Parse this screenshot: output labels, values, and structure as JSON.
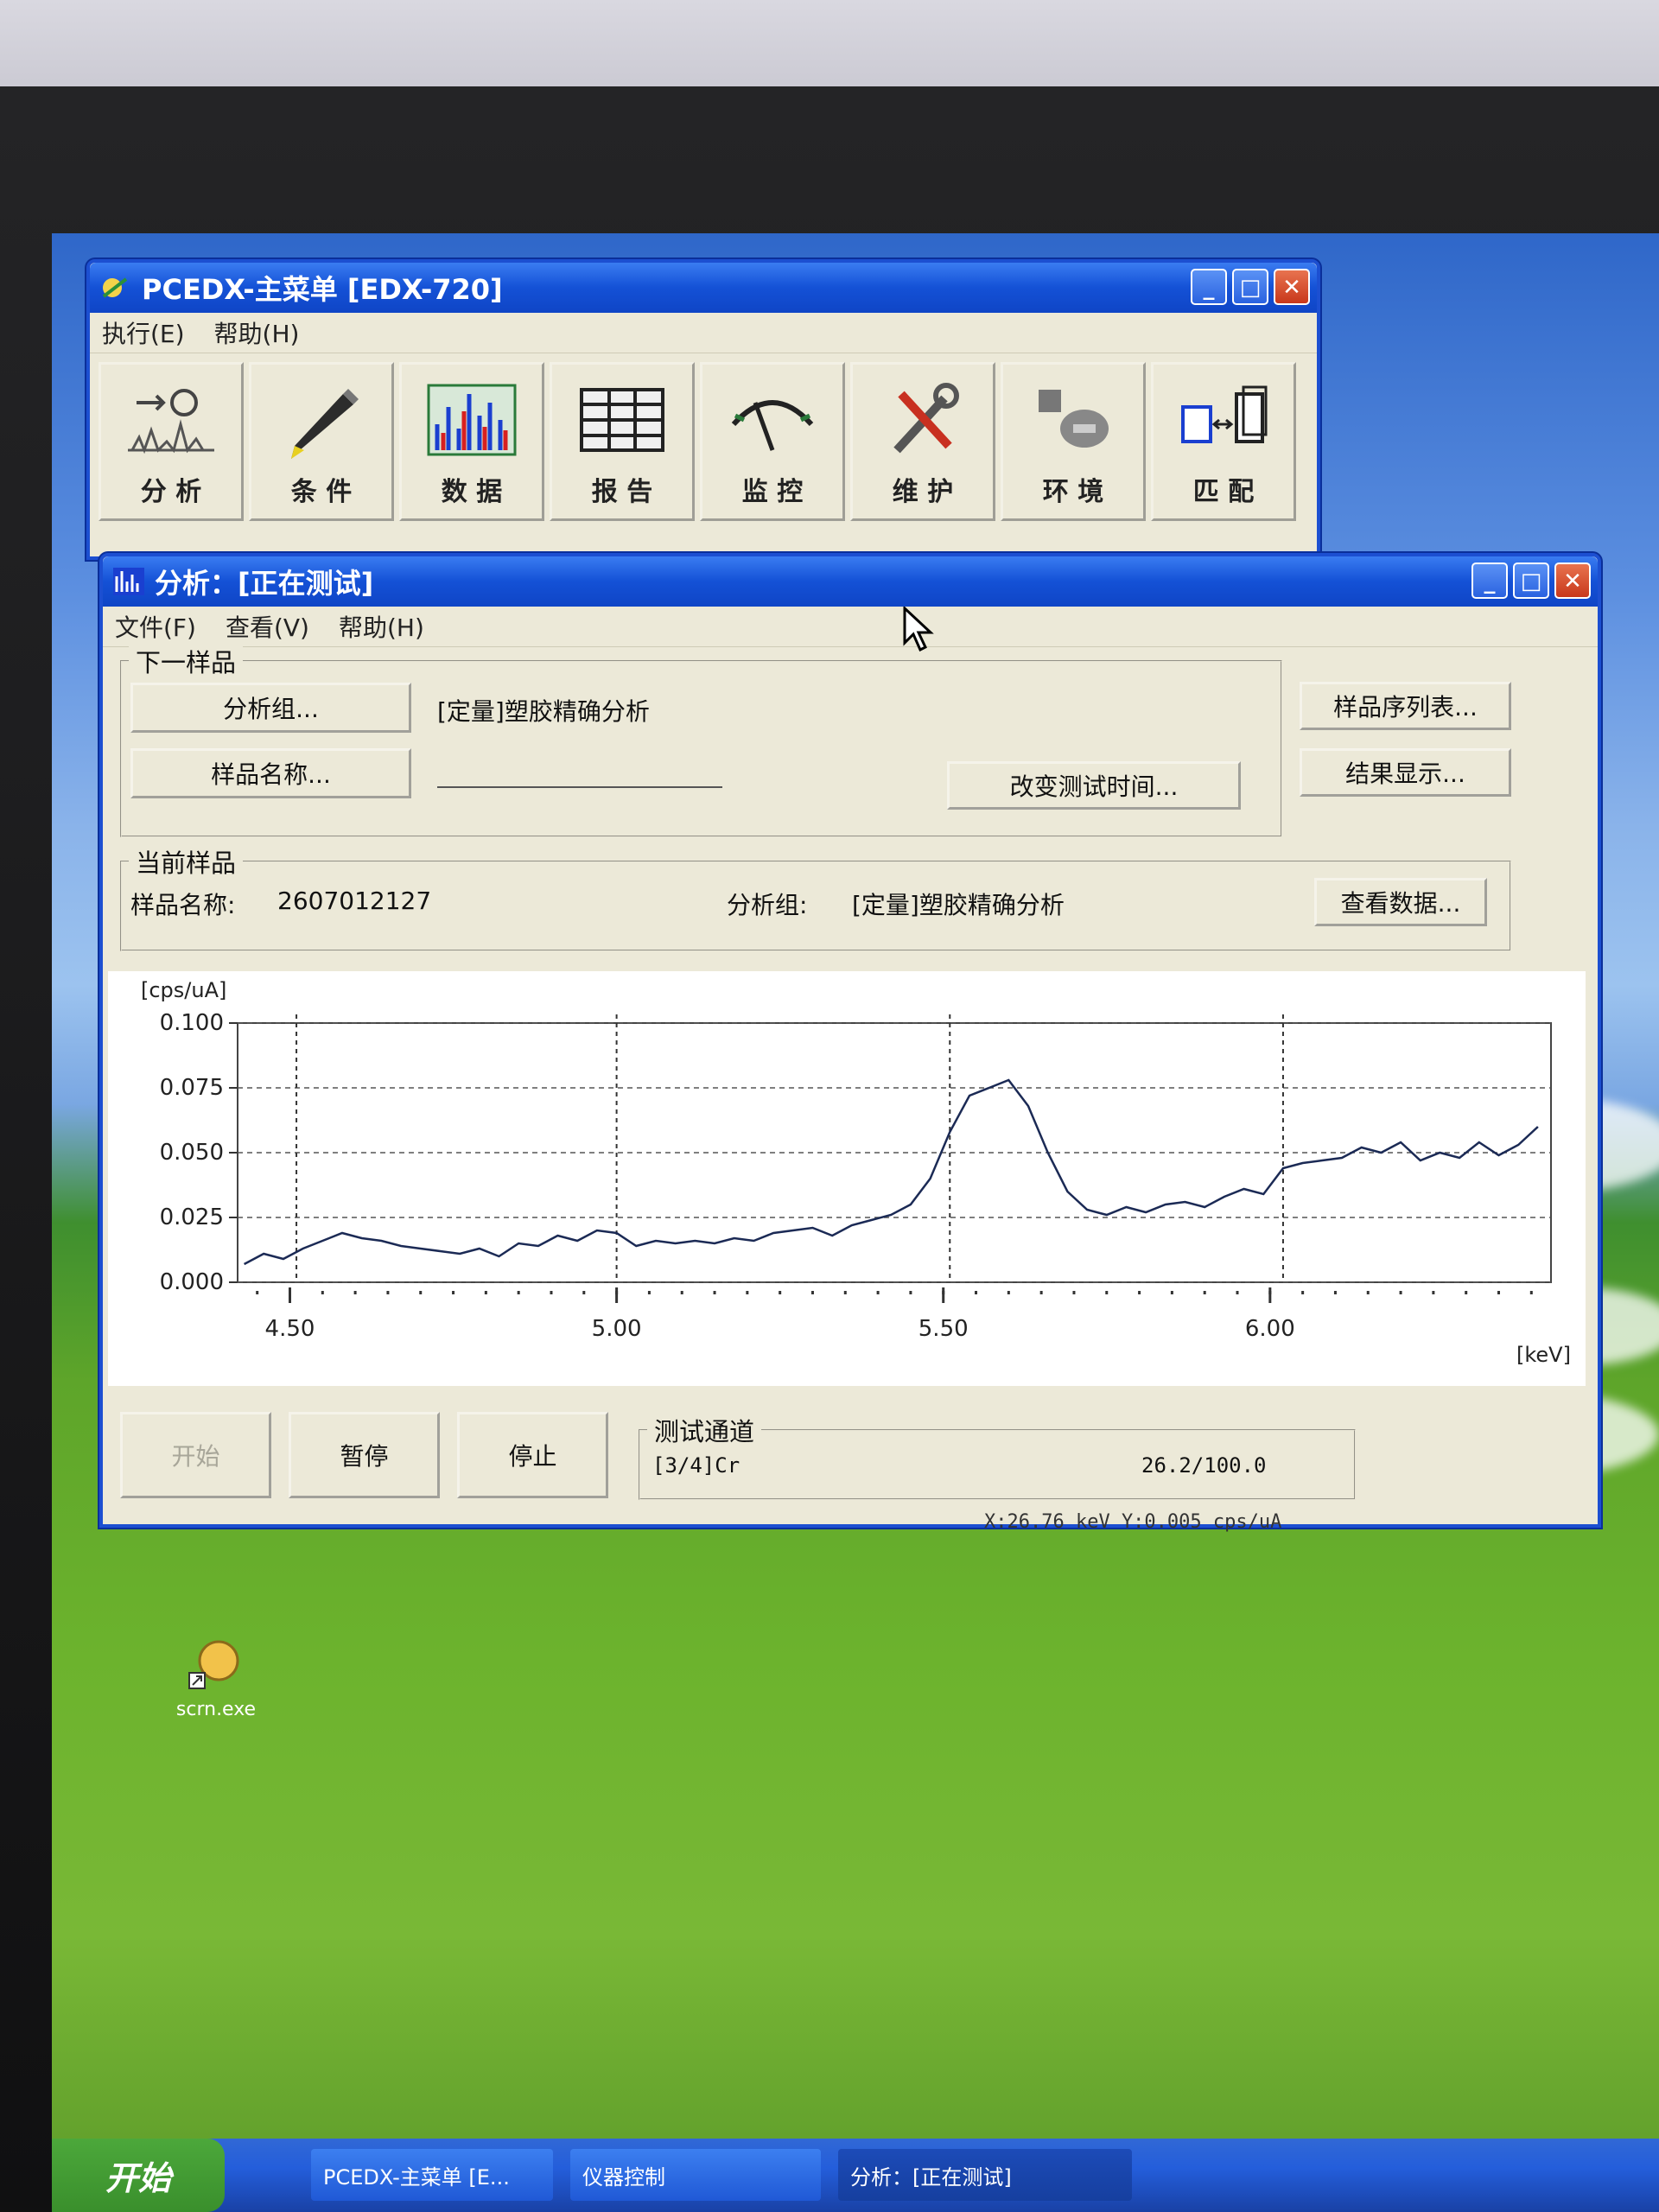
{
  "main_window": {
    "title": "PCEDX-主菜单   [EDX-720]",
    "menu": [
      "执行(E)",
      "帮助(H)"
    ],
    "toolbar": [
      {
        "label": "分 析",
        "icon": "spectrum-analysis-icon"
      },
      {
        "label": "条 件",
        "icon": "pencil-icon"
      },
      {
        "label": "数 据",
        "icon": "bar-chart-icon"
      },
      {
        "label": "报 告",
        "icon": "table-icon"
      },
      {
        "label": "监 控",
        "icon": "gauge-icon"
      },
      {
        "label": "维 护",
        "icon": "tools-icon"
      },
      {
        "label": "环 境",
        "icon": "disk-icon"
      },
      {
        "label": "匹 配",
        "icon": "match-icon"
      }
    ]
  },
  "analysis_window": {
    "title": "分析：[正在测试]",
    "menu": [
      "文件(F)",
      "查看(V)",
      "帮助(H)"
    ],
    "next_sample": {
      "group_label": "下一样品",
      "analysis_group_button": "分析组...",
      "analysis_group_value": "[定量]塑胶精确分析",
      "sample_name_button": "样品名称...",
      "sample_name_value": "",
      "change_time_button": "改变测试时间..."
    },
    "side_buttons": {
      "sample_list": "样品序列表...",
      "result_display": "结果显示..."
    },
    "current_sample": {
      "group_label": "当前样品",
      "sample_name_label": "样品名称:",
      "sample_name_value": "2607012127",
      "analysis_group_label": "分析组:",
      "analysis_group_value": "[定量]塑胶精确分析",
      "view_data_button": "查看数据..."
    },
    "controls": {
      "start": "开始",
      "pause": "暂停",
      "stop": "停止"
    },
    "channel": {
      "group_label": "测试通道",
      "name": "[3/4]Cr",
      "progress": "26.2/100.0"
    },
    "status_bar": "X:26.76 keV  Y:0.005 cps/uA"
  },
  "chart_data": {
    "type": "line",
    "ylabel": "[cps/uA]",
    "xlabel": "[keV]",
    "xlim": [
      4.42,
      6.43
    ],
    "ylim": [
      0.0,
      0.1
    ],
    "x_ticks": [
      "4.50",
      "5.00",
      "5.50",
      "6.00"
    ],
    "y_ticks": [
      "0.100",
      "0.075",
      "0.050",
      "0.025",
      "0.000"
    ],
    "marker_lines_kev": [
      4.51,
      5.0,
      5.51,
      6.02
    ],
    "series": [
      {
        "x": [
          4.43,
          4.46,
          4.49,
          4.52,
          4.55,
          4.58,
          4.61,
          4.64,
          4.67,
          4.7,
          4.73,
          4.76,
          4.79,
          4.82,
          4.85,
          4.88,
          4.91,
          4.94,
          4.97,
          5.0,
          5.03,
          5.06,
          5.09,
          5.12,
          5.15,
          5.18,
          5.21,
          5.24,
          5.27,
          5.3,
          5.33,
          5.36,
          5.39,
          5.42,
          5.45,
          5.48,
          5.51,
          5.54,
          5.57,
          5.6,
          5.63,
          5.66,
          5.69,
          5.72,
          5.75,
          5.78,
          5.81,
          5.84,
          5.87,
          5.9,
          5.93,
          5.96,
          5.99,
          6.02,
          6.05,
          6.08,
          6.11,
          6.14,
          6.17,
          6.2,
          6.23,
          6.26,
          6.29,
          6.32,
          6.35,
          6.38,
          6.41
        ],
        "y": [
          0.007,
          0.011,
          0.009,
          0.013,
          0.016,
          0.019,
          0.017,
          0.016,
          0.014,
          0.013,
          0.012,
          0.011,
          0.013,
          0.01,
          0.015,
          0.014,
          0.018,
          0.016,
          0.02,
          0.019,
          0.014,
          0.016,
          0.015,
          0.016,
          0.015,
          0.017,
          0.016,
          0.019,
          0.02,
          0.021,
          0.018,
          0.022,
          0.024,
          0.026,
          0.03,
          0.04,
          0.058,
          0.072,
          0.075,
          0.078,
          0.068,
          0.05,
          0.035,
          0.028,
          0.026,
          0.029,
          0.027,
          0.03,
          0.031,
          0.029,
          0.033,
          0.036,
          0.034,
          0.044,
          0.046,
          0.047,
          0.048,
          0.052,
          0.05,
          0.054,
          0.047,
          0.05,
          0.048,
          0.054,
          0.049,
          0.053,
          0.06
        ]
      }
    ]
  }
}
